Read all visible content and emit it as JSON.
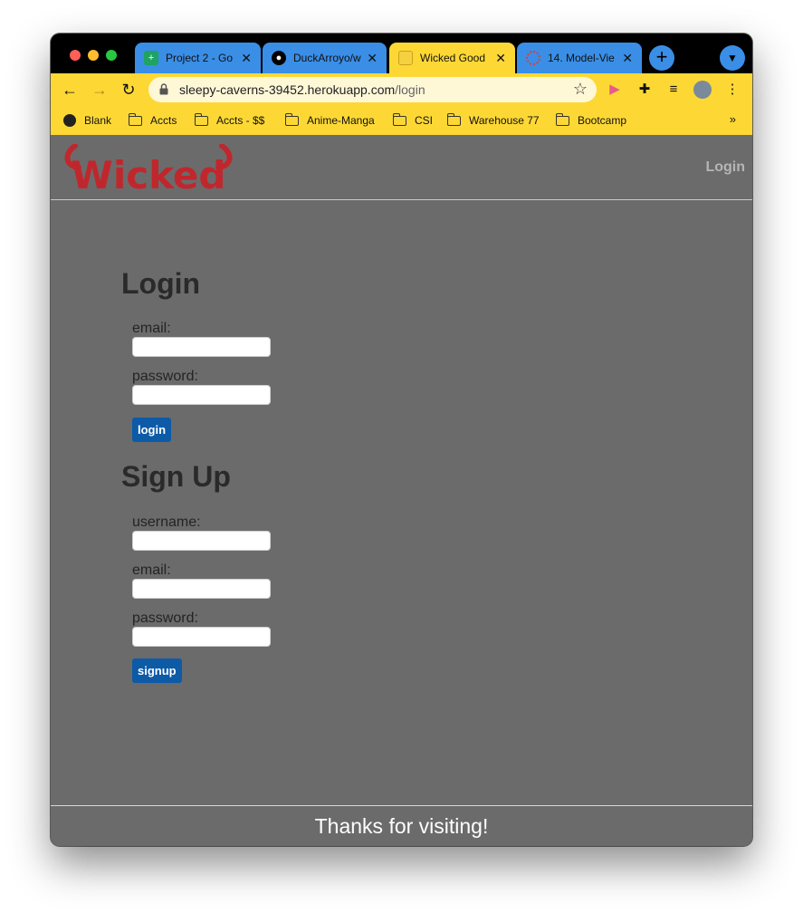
{
  "browser": {
    "tabs": [
      {
        "title": "Project 2 - Go",
        "icon": "sheets-icon",
        "color": "#1ea362"
      },
      {
        "title": "DuckArroyo/w",
        "icon": "github-icon",
        "color": "#000000"
      },
      {
        "title": "Wicked Good",
        "icon": "sponge-icon",
        "color": "#f5d142"
      },
      {
        "title": "14. Model-Vie",
        "icon": "circle-icon",
        "color": "#e53935"
      }
    ],
    "url_host": "sleepy-caverns-39452.herokuapp.com",
    "url_path": "/login",
    "bookmarks": [
      "Blank",
      "Accts",
      "Accts - $$",
      "Anime-Manga",
      "CSI",
      "Warehouse 77",
      "Bootcamp"
    ],
    "bookmarks_more": "»",
    "toolbar_color": "#fdd835",
    "tab_color": "#3a8ee6"
  },
  "site": {
    "logo_text": "Wicked",
    "nav_login": "Login",
    "login": {
      "title": "Login",
      "email_label": "email:",
      "password_label": "password:",
      "button": "login"
    },
    "signup": {
      "title": "Sign Up",
      "username_label": "username:",
      "email_label": "email:",
      "password_label": "password:",
      "button": "signup"
    },
    "footer": "Thanks for visiting!",
    "background": "#6b6b6b",
    "button_color": "#0d5aa7",
    "logo_color": "#c0272d"
  }
}
